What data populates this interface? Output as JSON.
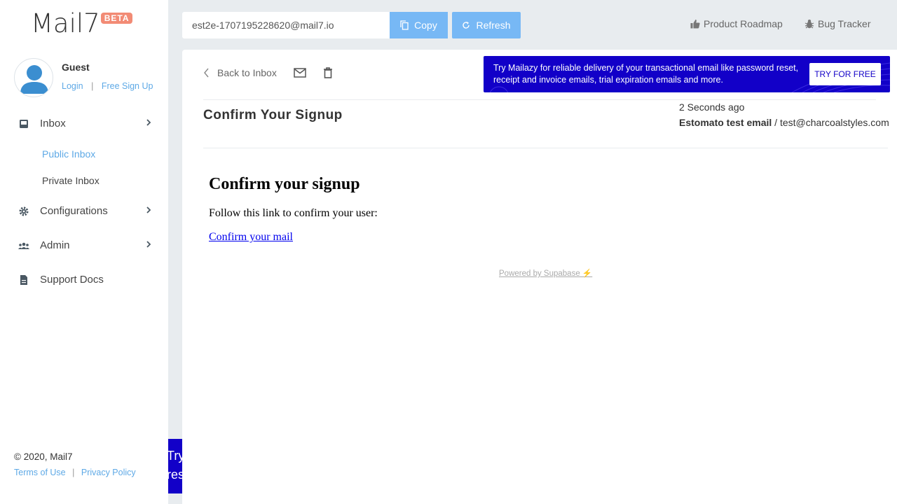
{
  "sidebar": {
    "logo": "Mail7",
    "beta": "BETA",
    "user": {
      "name": "Guest",
      "login": "Login",
      "signup": "Free Sign Up",
      "sep": "|"
    },
    "nav": {
      "inbox": "Inbox",
      "public_inbox": "Public Inbox",
      "private_inbox": "Private Inbox",
      "configurations": "Configurations",
      "admin": "Admin",
      "support_docs": "Support Docs"
    },
    "footer": {
      "copyright": "© 2020, Mail7",
      "terms": "Terms of Use",
      "privacy": "Privacy Policy",
      "sep": "|"
    }
  },
  "topbar": {
    "email": "est2e-1707195228620@mail7.io",
    "copy": "Copy",
    "refresh": "Refresh",
    "roadmap": "Product Roadmap",
    "bugs": "Bug Tracker"
  },
  "message": {
    "back": "Back to Inbox",
    "subject": "Confirm Your Signup",
    "time": "2 Seconds ago",
    "from_name": "Estomato test email",
    "from_sep": " / ",
    "from_email": "test@charcoalstyles.com",
    "body_heading": "Confirm your signup",
    "body_text": "Follow this link to confirm your user:",
    "body_link": "Confirm your mail",
    "powered": "Powered by Supabase ⚡"
  },
  "ad": {
    "text": "Try Mailazy for reliable delivery of your transactional email like password reset, receipt and invoice emails, trial expiration emails and more.",
    "button": "TRY FOR FREE",
    "mini_line1": "Try",
    "mini_line2": "res"
  },
  "colors": {
    "accent": "#5ea9e6",
    "button": "#77b8f5",
    "ad_bg": "#1200c8",
    "beta": "#f28b75"
  }
}
